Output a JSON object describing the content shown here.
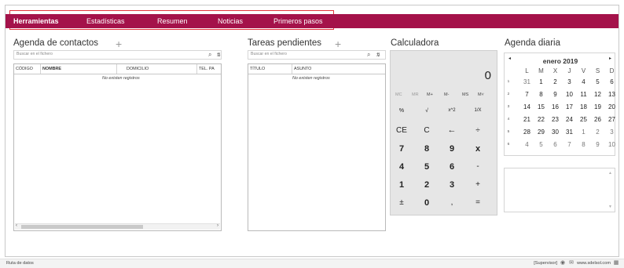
{
  "menu": {
    "tabs": [
      {
        "label": "Herramientas",
        "active": true
      },
      {
        "label": "Estadísticas",
        "active": false
      },
      {
        "label": "Resumen",
        "active": false
      },
      {
        "label": "Noticias",
        "active": false
      },
      {
        "label": "Primeros pasos",
        "active": false
      }
    ],
    "bar_color": "#a4124a",
    "highlight_color": "#e0343c"
  },
  "contacts": {
    "title": "Agenda de contactos",
    "add_icon": "plus-icon",
    "search_placeholder": "Buscar en el fichero",
    "search_icon": "search-icon",
    "filter_icon": "filter-icon",
    "columns": [
      "CÓDIGO",
      "NOMBRE",
      "DOMICILIO",
      "TEL. PA"
    ],
    "empty_text": "No existen registros"
  },
  "tasks": {
    "title": "Tareas pendientes",
    "add_icon": "plus-icon",
    "search_placeholder": "Buscar en el fichero",
    "columns": [
      "TÍTULO",
      "ASUNTO"
    ],
    "empty_text": "No existen registros"
  },
  "calculator": {
    "title": "Calculadora",
    "display": "0",
    "memory_keys": [
      "MC",
      "MR",
      "M+",
      "M-",
      "MS",
      "M˅"
    ],
    "function_keys": [
      "%",
      "√",
      "x^2",
      "1/X"
    ],
    "rows": [
      [
        "CE",
        "C",
        "←",
        "÷"
      ],
      [
        "7",
        "8",
        "9",
        "x"
      ],
      [
        "4",
        "5",
        "6",
        "-"
      ],
      [
        "1",
        "2",
        "3",
        "+"
      ],
      [
        "±",
        "0",
        ",",
        "="
      ]
    ]
  },
  "agenda": {
    "title": "Agenda diaria",
    "month": "enero 2019",
    "prev": "◂",
    "next": "▸",
    "weekdays": [
      "L",
      "M",
      "X",
      "J",
      "V",
      "S",
      "D"
    ],
    "weeks": [
      {
        "n": "1",
        "days": [
          "31",
          "1",
          "2",
          "3",
          "4",
          "5",
          "6"
        ]
      },
      {
        "n": "2",
        "days": [
          "7",
          "8",
          "9",
          "10",
          "11",
          "12",
          "13"
        ]
      },
      {
        "n": "3",
        "days": [
          "14",
          "15",
          "16",
          "17",
          "18",
          "19",
          "20"
        ]
      },
      {
        "n": "4",
        "days": [
          "21",
          "22",
          "23",
          "24",
          "25",
          "26",
          "27"
        ]
      },
      {
        "n": "5",
        "days": [
          "28",
          "29",
          "30",
          "31",
          "1",
          "2",
          "3"
        ]
      },
      {
        "n": "6",
        "days": [
          "4",
          "5",
          "6",
          "7",
          "8",
          "9",
          "10"
        ]
      }
    ]
  },
  "status": {
    "left": "Ruta de datos",
    "user": "[Supervisor]",
    "link": "www.sdelsol.com"
  }
}
